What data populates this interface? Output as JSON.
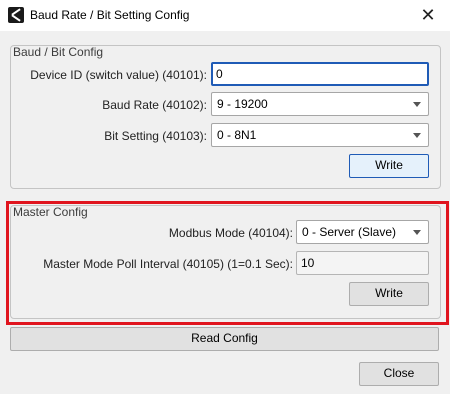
{
  "window": {
    "title": "Baud Rate / Bit Setting Config",
    "close_glyph": "✕"
  },
  "baud_group": {
    "title": "Baud / Bit Config",
    "device_id_label": "Device ID (switch value) (40101):",
    "device_id_value": "0",
    "baud_label": "Baud Rate (40102):",
    "baud_value": "9 - 19200",
    "bit_label": "Bit Setting (40103):",
    "bit_value": "0 - 8N1",
    "write_label": "Write"
  },
  "master_group": {
    "title": "Master Config",
    "mode_label": "Modbus Mode (40104):",
    "mode_value": "0 - Server (Slave)",
    "poll_label": "Master Mode Poll Interval (40105) (1=0.1 Sec):",
    "poll_value": "10",
    "write_label": "Write"
  },
  "read_config_label": "Read Config",
  "close_label": "Close",
  "colors": {
    "highlight": "#e0141e",
    "focus": "#1f5bb6"
  }
}
